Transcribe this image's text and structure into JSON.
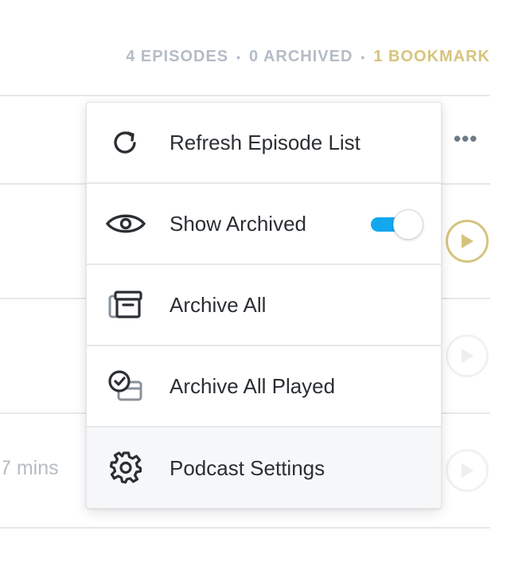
{
  "header": {
    "episodes": "4 EPISODES",
    "separator": "•",
    "archived": "0 ARCHIVED",
    "bookmarks": "1 BOOKMARK"
  },
  "background": {
    "more_icon": "more-horizontal-icon",
    "duration_partial": "7 mins",
    "play_icon": "play-icon"
  },
  "colors": {
    "accent_gold": "#d6c47e",
    "toggle_on": "#12a7ee",
    "muted_text": "#b4bcc6",
    "primary_text": "#2b2f33"
  },
  "menu": {
    "items": [
      {
        "icon": "refresh-icon",
        "label": "Refresh Episode List"
      },
      {
        "icon": "eye-icon",
        "label": "Show Archived",
        "toggle_on": true
      },
      {
        "icon": "archive-box-icon",
        "label": "Archive All"
      },
      {
        "icon": "check-archive-icon",
        "label": "Archive All Played"
      },
      {
        "icon": "gear-icon",
        "label": "Podcast Settings"
      }
    ]
  }
}
